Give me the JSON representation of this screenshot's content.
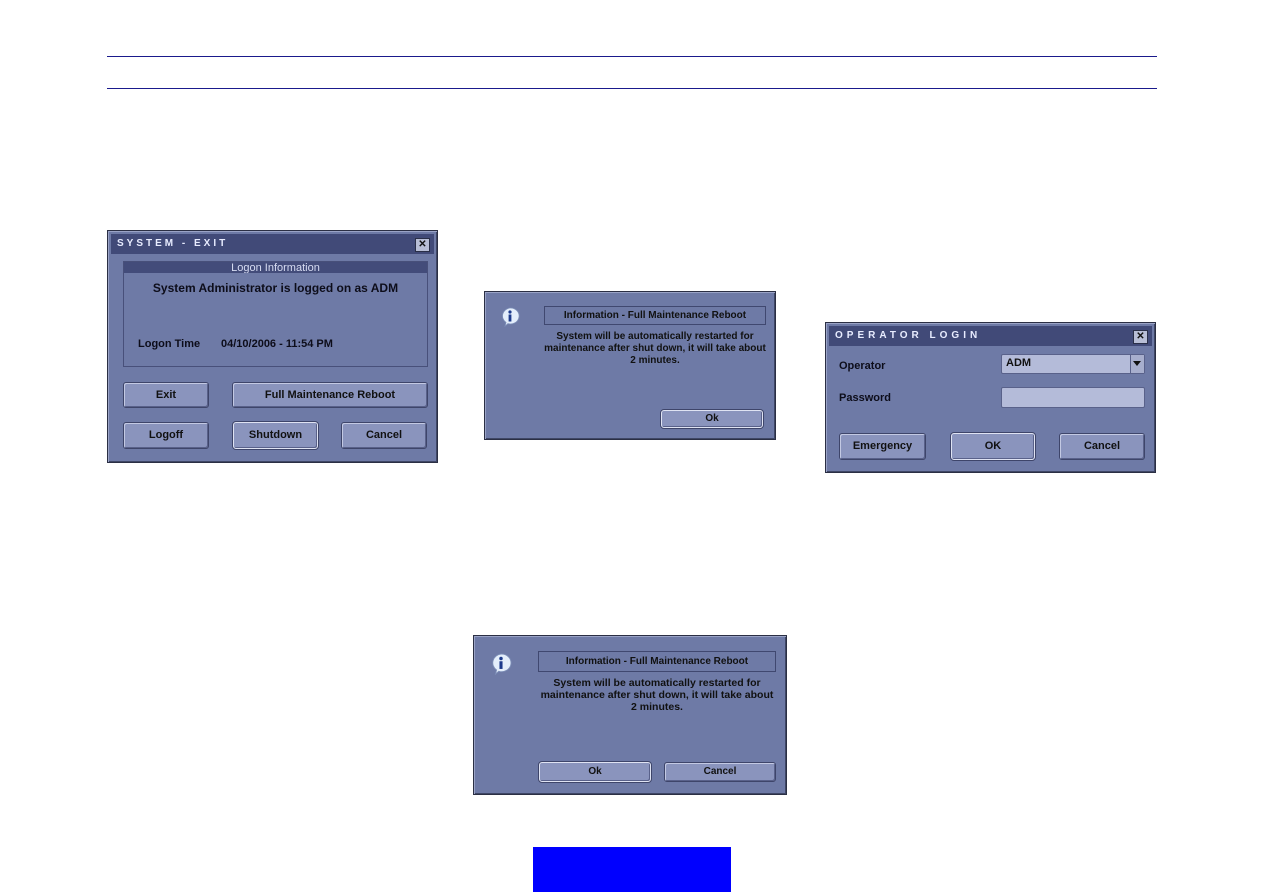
{
  "colors": {
    "dialog_bg": "#6e7aa6",
    "titlebar_bg": "#414a78",
    "button_bg": "#8a94bd",
    "rule_line": "#1a1a8c",
    "footer_block": "#0000ff"
  },
  "system_exit": {
    "title": "SYSTEM - EXIT",
    "close_icon": "close-icon",
    "group_title": "Logon Information",
    "logged_message": "System Administrator is logged on as ADM",
    "logon_time_label": "Logon Time",
    "logon_time_value": "04/10/2006 - 11:54 PM",
    "buttons": {
      "exit": "Exit",
      "full_reboot": "Full Maintenance Reboot",
      "logoff": "Logoff",
      "shutdown": "Shutdown",
      "cancel": "Cancel"
    }
  },
  "info_dialog_1": {
    "icon": "info-icon",
    "title": "Information - Full Maintenance Reboot",
    "message_lines": [
      "System will be automatically restarted for",
      "maintenance after shut down, it will take about",
      "2 minutes."
    ],
    "ok": "Ok"
  },
  "operator_login": {
    "title": "OPERATOR LOGIN",
    "close_icon": "close-icon",
    "operator_label": "Operator",
    "operator_value": "ADM",
    "password_label": "Password",
    "password_value": "",
    "buttons": {
      "emergency": "Emergency",
      "ok": "OK",
      "cancel": "Cancel"
    }
  },
  "info_dialog_2": {
    "icon": "info-icon",
    "title": "Information - Full Maintenance Reboot",
    "message_lines": [
      "System will be automatically restarted for",
      "maintenance after shut down, it will take about",
      "2 minutes."
    ],
    "ok": "Ok",
    "cancel": "Cancel"
  }
}
